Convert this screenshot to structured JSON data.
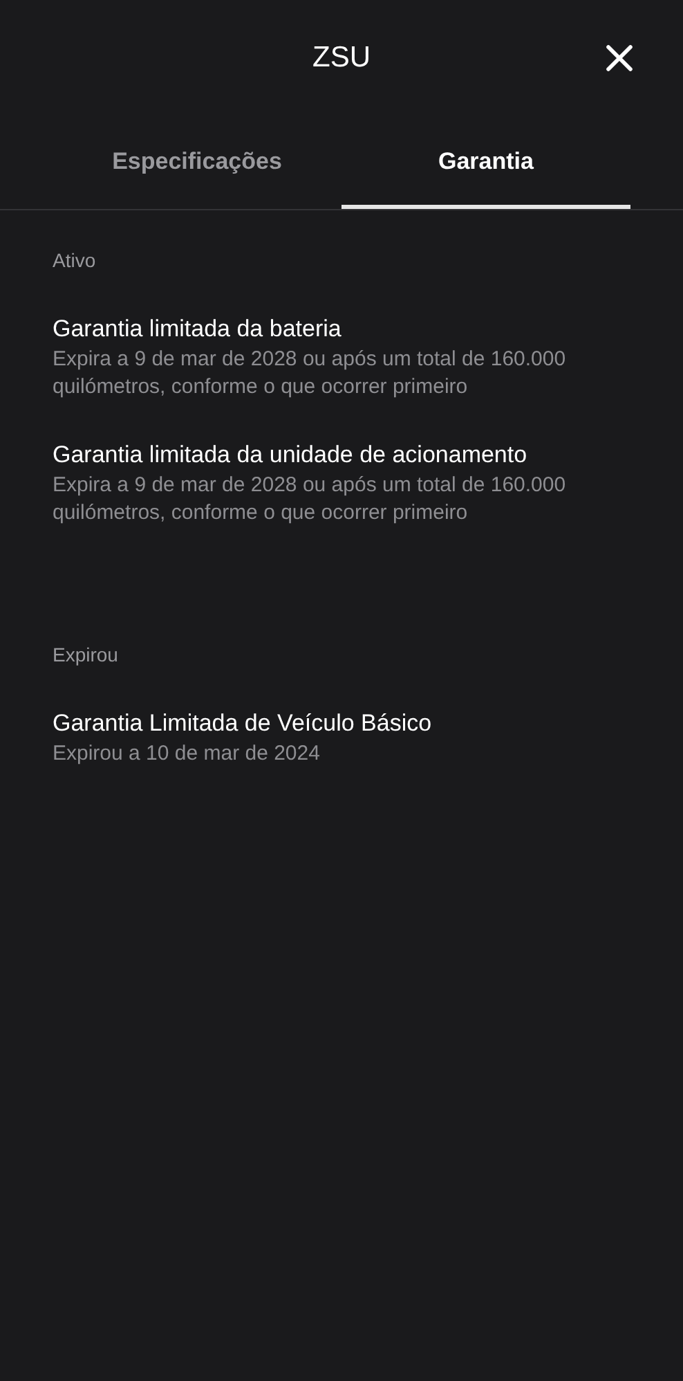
{
  "header": {
    "title": "ZSU"
  },
  "tabs": [
    {
      "label": "Especificações",
      "selected": false
    },
    {
      "label": "Garantia",
      "selected": true
    }
  ],
  "sections": [
    {
      "heading": "Ativo",
      "items": [
        {
          "title": "Garantia limitada da bateria",
          "detail": "Expira a 9 de mar de 2028 ou após um total de 160.000 quilómetros, conforme o que ocorrer primeiro"
        },
        {
          "title": "Garantia limitada da unidade de acionamento",
          "detail": "Expira a 9 de mar de 2028 ou após um total de 160.000 quilómetros, conforme o que ocorrer primeiro"
        }
      ]
    },
    {
      "heading": "Expirou",
      "items": [
        {
          "title": "Garantia Limitada de Veículo Básico",
          "detail": "Expirou a 10 de mar de 2024"
        }
      ]
    }
  ]
}
